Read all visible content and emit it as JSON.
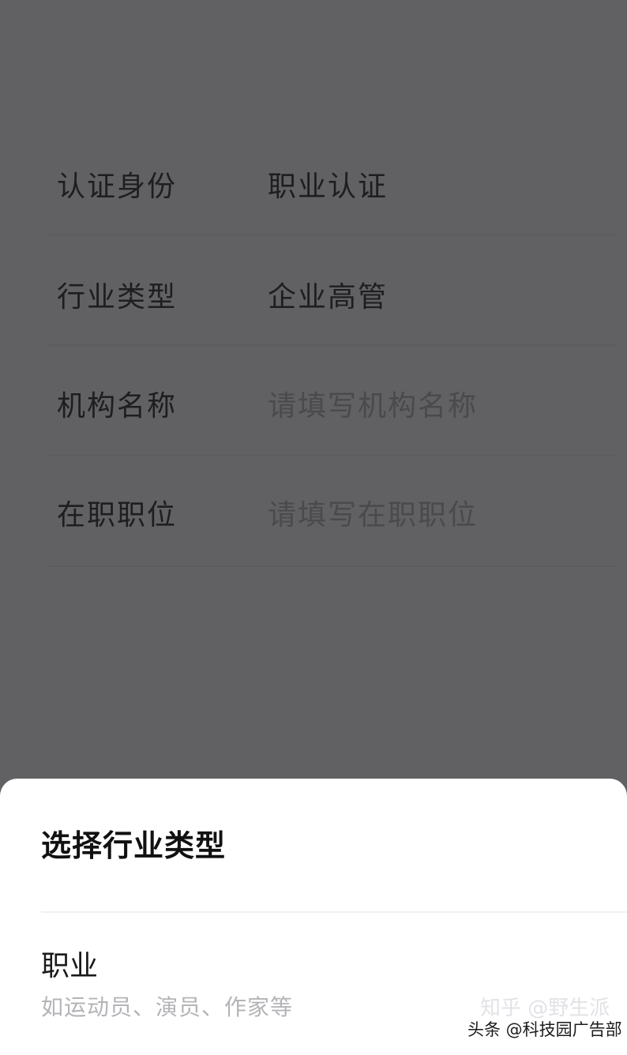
{
  "form": {
    "rows": [
      {
        "label": "认证身份",
        "value": "职业认证"
      },
      {
        "label": "行业类型",
        "value": "企业高管"
      },
      {
        "label": "机构名称",
        "placeholder": "请填写机构名称"
      },
      {
        "label": "在职职位",
        "placeholder": "请填写在职职位"
      }
    ]
  },
  "sheet": {
    "title": "选择行业类型",
    "options": [
      {
        "title": "职业",
        "description": "如运动员、演员、作家等"
      }
    ]
  },
  "watermarks": {
    "faint": "知乎 @野生派",
    "main": "头条 @科技园广告部"
  }
}
